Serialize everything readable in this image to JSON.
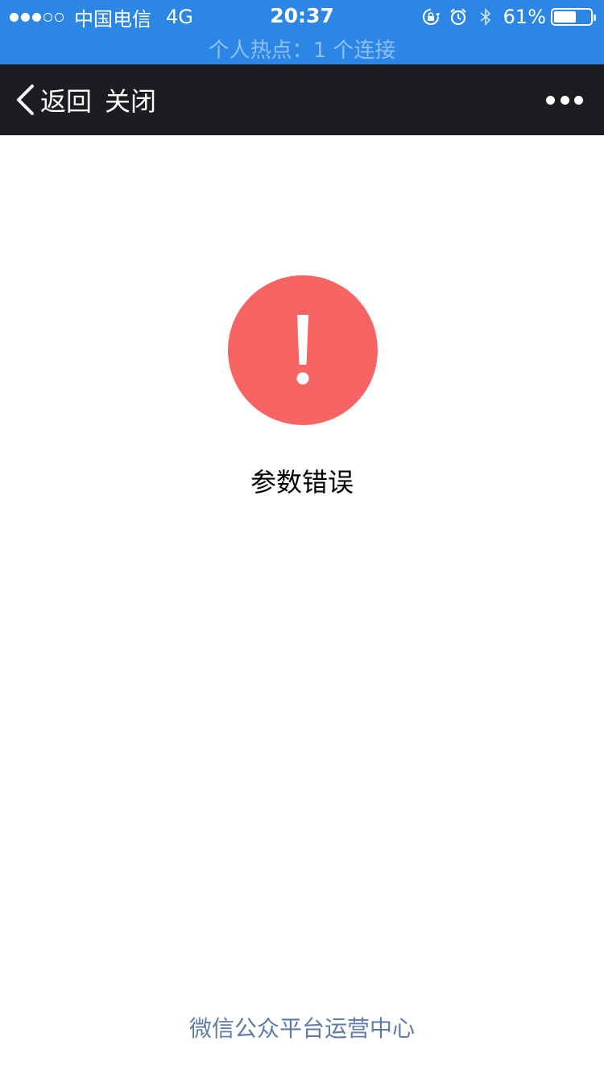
{
  "status_bar": {
    "carrier": "中国电信",
    "network": "4G",
    "time": "20:37",
    "battery_percent_text": "61%",
    "battery_level": 0.61,
    "hotspot_text": "个人热点：1 个连接",
    "signal_bars_filled": 3,
    "signal_bars_total": 5,
    "icons": [
      "signal-dots-icon",
      "rotation-lock-icon",
      "alarm-icon",
      "bluetooth-icon",
      "battery-icon"
    ],
    "color": "#2b86e5"
  },
  "nav": {
    "back_label": "返回",
    "close_label": "关闭",
    "more_icon": "more-dots-icon",
    "color": "#1d1d21"
  },
  "main": {
    "error_icon": "exclamation-icon",
    "error_color": "#f86363",
    "message": "参数错误"
  },
  "footer": {
    "link_text": "微信公众平台运营中心",
    "link_color": "#5d7ba6"
  }
}
